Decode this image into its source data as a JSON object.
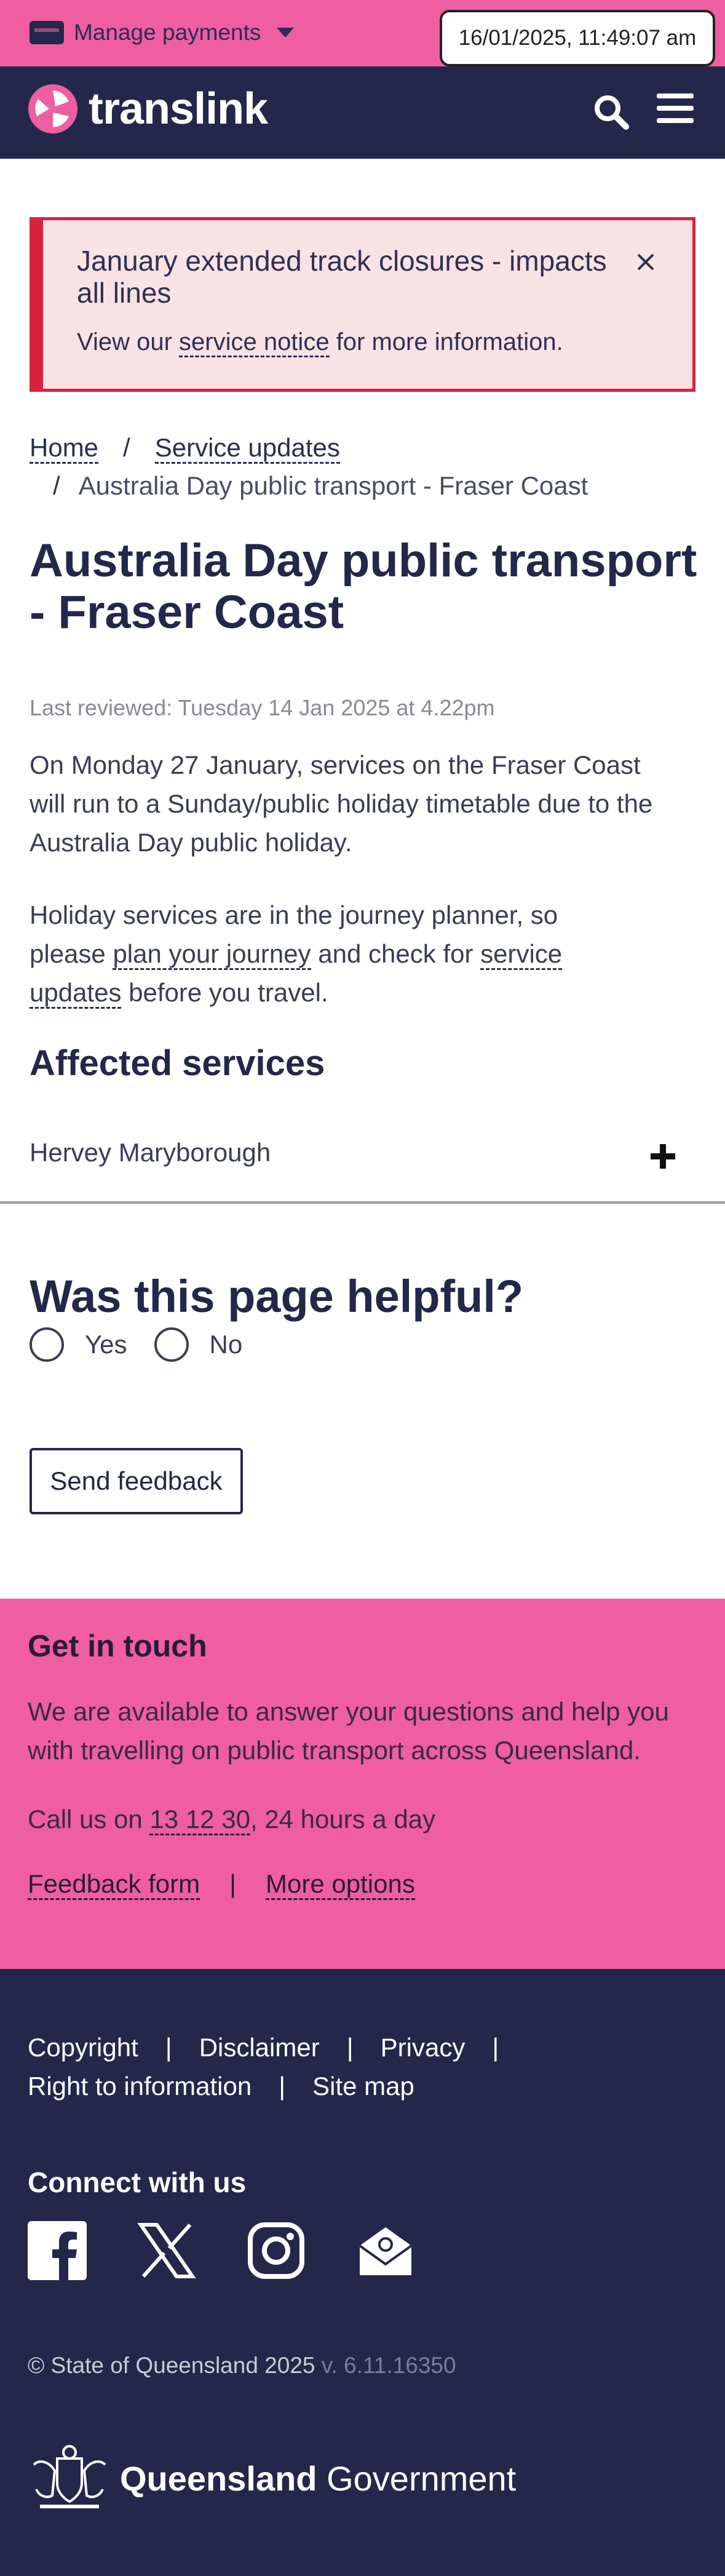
{
  "topbar": {
    "manage_payments": "Manage payments",
    "timestamp": "16/01/2025, 11:49:07 am"
  },
  "header": {
    "logo_text": "translink"
  },
  "alert": {
    "title": "January extended track closures - impacts all lines",
    "body_prefix": "View our ",
    "body_link": "service notice",
    "body_suffix": " for more information."
  },
  "breadcrumb": {
    "home": "Home",
    "sep": "/",
    "service_updates": "Service updates",
    "current": "Australia Day public transport - Fraser Coast"
  },
  "page": {
    "title": "Australia Day public transport - Fraser Coast",
    "last_reviewed": "Last reviewed: Tuesday 14 Jan 2025 at 4.22pm",
    "para1": "On Monday 27 January, services on the Fraser Coast will run to a Sunday/public holiday timetable due to the Australia Day public holiday.",
    "para2_a": "Holiday services are in the journey planner, so please ",
    "para2_link1": "plan your journey",
    "para2_b": " and check for ",
    "para2_link2": "service updates",
    "para2_c": " before you travel.",
    "affected_heading": "Affected services",
    "accordion_item": "Hervey Maryborough"
  },
  "feedback": {
    "heading": "Was this page helpful?",
    "yes": "Yes",
    "no": "No",
    "send": "Send feedback"
  },
  "contact": {
    "heading": "Get in touch",
    "text": "We are available to answer your questions and help you with travelling on public transport across Queensland.",
    "call_prefix": "Call us on ",
    "phone": "13 12 30",
    "call_suffix": ", 24 hours a day",
    "feedback_form": "Feedback form",
    "pipe": "|",
    "more_options": "More options"
  },
  "footer": {
    "copyright_link": "Copyright",
    "disclaimer": "Disclaimer",
    "privacy": "Privacy",
    "right_to_information": "Right to information",
    "site_map": "Site map",
    "pipe": "|",
    "connect_heading": "Connect with us",
    "copyright_text": "© State of Queensland 2025",
    "version": "v. 6.11.16350",
    "qld_bold": "Queensland",
    "qld_regular": " Government"
  },
  "icons": [
    "credit-card-icon",
    "caret-down-icon",
    "search-icon",
    "menu-icon",
    "close-icon",
    "plus-icon",
    "facebook-icon",
    "x-icon",
    "instagram-icon",
    "email-icon",
    "queensland-crest-icon"
  ],
  "colors": {
    "brand_pink": "#ef5ea1",
    "navy": "#23284a",
    "alert_red": "#d8233e",
    "alert_bg": "#f9e2e5"
  }
}
